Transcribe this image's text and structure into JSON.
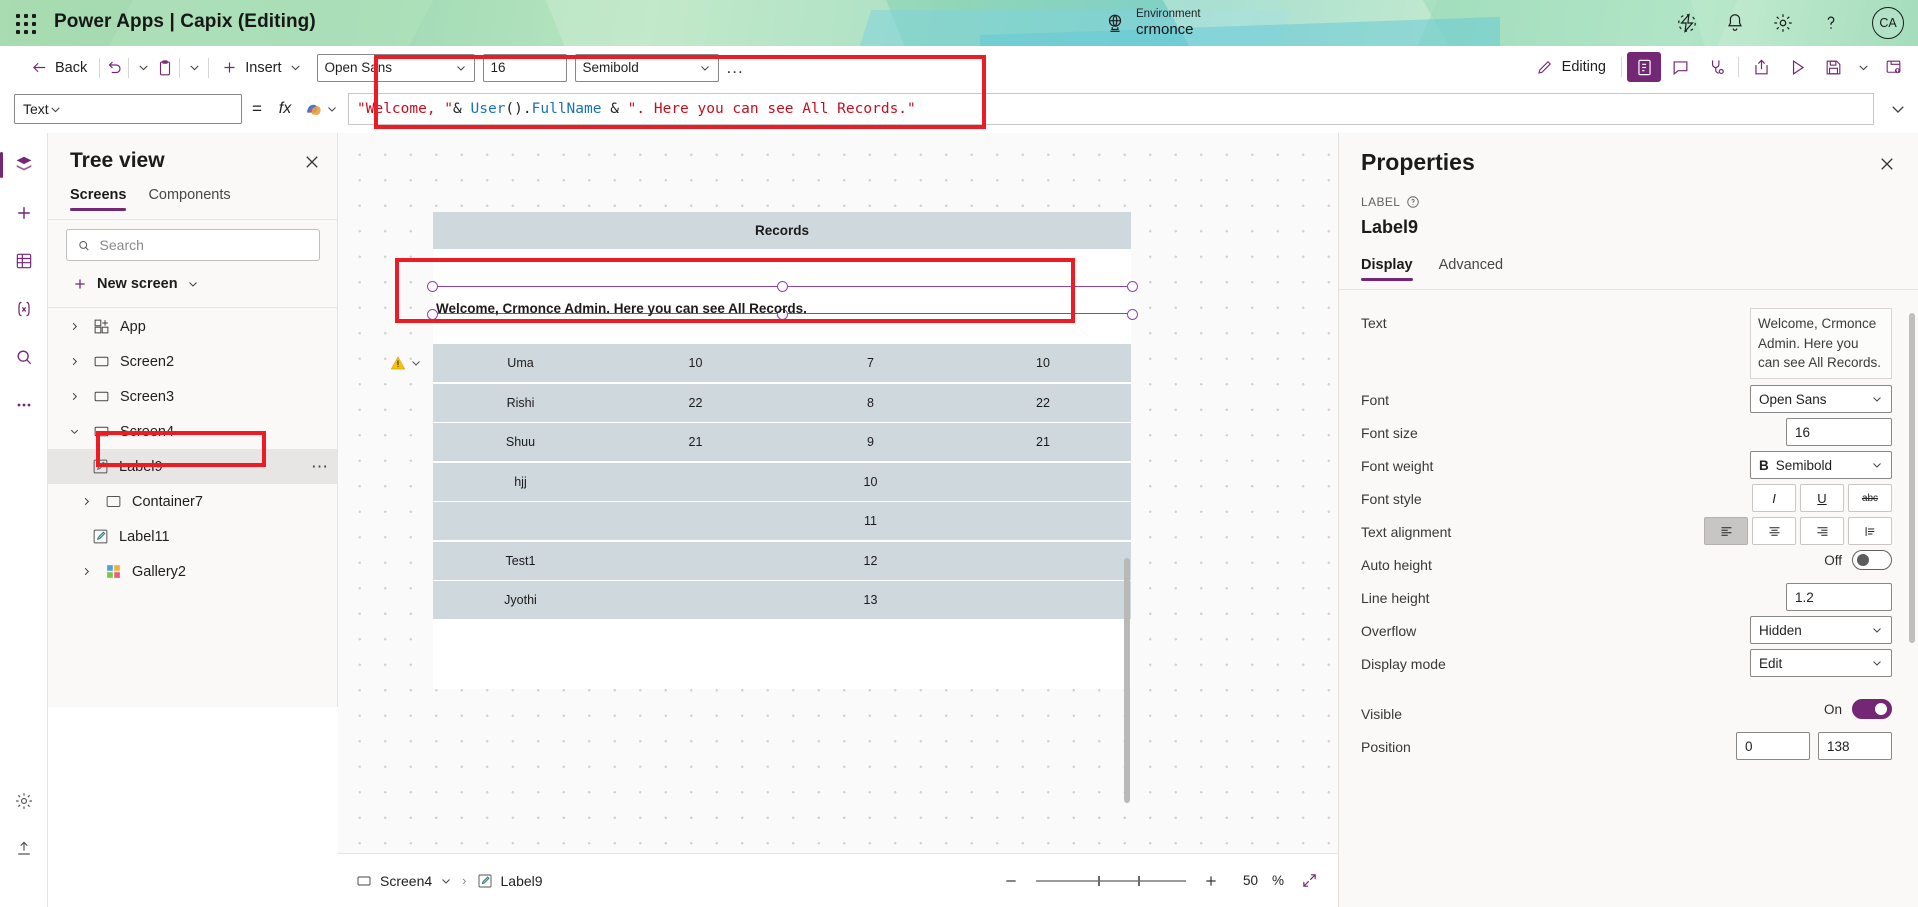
{
  "header": {
    "brand": "Power Apps  |  Capix (Editing)",
    "waffle_icon": "app-launcher-icon",
    "environment_label": "Environment",
    "environment_name": "crmonce",
    "globe_icon": "globe-icon",
    "icons": [
      "diagnostics-icon",
      "notification-bell-icon",
      "settings-gear-icon",
      "help-question-icon"
    ],
    "avatar_initials": "CA",
    "accent_color": "#742774",
    "header_color": "#9fd9b4"
  },
  "toolbar": {
    "back_label": "Back",
    "back_icon": "arrow-left-icon",
    "undo_icon": "undo-icon",
    "undo_caret_icon": "chevron-down-icon",
    "paste_icon": "clipboard-paste-icon",
    "paste_caret_icon": "chevron-down-icon",
    "insert_label": "Insert",
    "insert_icon": "plus-icon",
    "insert_caret_icon": "chevron-down-icon",
    "font_family": "Open Sans",
    "font_size": "16",
    "font_weight": "Semibold",
    "overflow_label": "...",
    "editing_label": "Editing",
    "edit_icon": "pencil-icon",
    "right_icons": [
      "app-checker-icon",
      "comments-icon",
      "app-health-icon",
      "share-icon",
      "preview-play-icon",
      "save-icon",
      "save-caret-icon",
      "publish-icon"
    ]
  },
  "formula_bar": {
    "property": "Text",
    "property_caret_icon": "chevron-down-icon",
    "equals": "=",
    "fx_icon": "fx",
    "copilot_icon": "copilot-icon",
    "copilot_caret_icon": "chevron-down-icon",
    "formula_parts": [
      {
        "t": "\"Welcome, \"",
        "c": "str"
      },
      {
        "t": "& ",
        "c": "op"
      },
      {
        "t": "User",
        "c": "fn"
      },
      {
        "t": "().",
        "c": "op"
      },
      {
        "t": "FullName",
        "c": "fn"
      },
      {
        "t": " & ",
        "c": "op"
      },
      {
        "t": "\". Here you can see All Records.\"",
        "c": "str"
      }
    ],
    "formula_plain": "\"Welcome, \"& User().FullName & \". Here you can see All Records.\"",
    "expand_icon": "chevron-down-icon"
  },
  "tree_view": {
    "title": "Tree view",
    "close_icon": "close-icon",
    "tabs": [
      {
        "label": "Screens",
        "active": true
      },
      {
        "label": "Components",
        "active": false
      }
    ],
    "search": {
      "placeholder": "Search",
      "value": "",
      "icon": "search-icon"
    },
    "new_screen": {
      "label": "New screen",
      "icon": "plus-icon",
      "caret_icon": "chevron-down-icon"
    },
    "nodes": [
      {
        "label": "App",
        "icon": "app-icon",
        "indent": 0,
        "chevron": "right",
        "selected": false
      },
      {
        "label": "Screen2",
        "icon": "screen-icon",
        "indent": 0,
        "chevron": "right",
        "selected": false
      },
      {
        "label": "Screen3",
        "icon": "screen-icon",
        "indent": 0,
        "chevron": "right",
        "selected": false
      },
      {
        "label": "Screen4",
        "icon": "screen-icon",
        "indent": 0,
        "chevron": "down",
        "selected": false
      },
      {
        "label": "Label9",
        "icon": "label-icon",
        "indent": 1,
        "chevron": "none",
        "selected": true,
        "more_icon": "more-options-icon"
      },
      {
        "label": "Container7",
        "icon": "container-icon",
        "indent": 1,
        "chevron": "right",
        "selected": false
      },
      {
        "label": "Label11",
        "icon": "label-icon",
        "indent": 1,
        "chevron": "none",
        "selected": false
      },
      {
        "label": "Gallery2",
        "icon": "gallery-icon",
        "indent": 1,
        "chevron": "right",
        "selected": false
      }
    ]
  },
  "rail": {
    "items": [
      "tree-view-icon",
      "insert-icon",
      "data-icon",
      "variables-icon",
      "search-icon",
      "more-icon",
      "settings-icon",
      "publish-icon"
    ]
  },
  "canvas": {
    "table_title": "Records",
    "selected_label_text": "Welcome, Crmonce Admin. Here you can see All Records.",
    "warning_icon": "warning-triangle-icon",
    "warning_caret_icon": "chevron-down-icon",
    "rows": [
      {
        "c1": "Uma",
        "c2": "10",
        "c3": "7",
        "c4": "10"
      },
      {
        "c1": "Rishi",
        "c2": "22",
        "c3": "8",
        "c4": "22"
      },
      {
        "c1": "Shuu",
        "c2": "21",
        "c3": "9",
        "c4": "21"
      },
      {
        "c1": "hjj",
        "c2": "",
        "c3": "10",
        "c4": ""
      },
      {
        "c1": "",
        "c2": "",
        "c3": "11",
        "c4": ""
      },
      {
        "c1": "Test1",
        "c2": "",
        "c3": "12",
        "c4": ""
      },
      {
        "c1": "Jyothi",
        "c2": "",
        "c3": "13",
        "c4": ""
      }
    ]
  },
  "properties": {
    "title": "Properties",
    "close_icon": "close-icon",
    "kind_label": "LABEL",
    "help_icon": "help-circle-icon",
    "control_name": "Label9",
    "tabs": [
      {
        "label": "Display",
        "active": true
      },
      {
        "label": "Advanced",
        "active": false
      }
    ],
    "fields": {
      "text_label": "Text",
      "text_value": "Welcome, Crmonce Admin. Here you can see All Records.",
      "font_label": "Font",
      "font_value": "Open Sans",
      "font_size_label": "Font size",
      "font_size_value": "16",
      "font_weight_label": "Font weight",
      "font_weight_value": "Semibold",
      "font_weight_bold_glyph": "B",
      "font_style_label": "Font style",
      "font_style_italic": "I",
      "font_style_underline": "U",
      "font_style_strike": "abc",
      "text_alignment_label": "Text alignment",
      "text_alignment_options": [
        "align-left",
        "align-center",
        "align-right",
        "align-justify"
      ],
      "text_alignment_selected": 0,
      "auto_height_label": "Auto height",
      "auto_height_state": "Off",
      "line_height_label": "Line height",
      "line_height_value": "1.2",
      "overflow_label": "Overflow",
      "overflow_value": "Hidden",
      "display_mode_label": "Display mode",
      "display_mode_value": "Edit",
      "visible_label": "Visible",
      "visible_state": "On",
      "position_label": "Position",
      "position_x": "0",
      "position_y": "138"
    }
  },
  "status_bar": {
    "screen_name": "Screen4",
    "screen_icon": "screen-icon",
    "screen_caret_icon": "chevron-down-icon",
    "control_name": "Label9",
    "control_icon": "label-icon",
    "zoom_out_icon": "minus-icon",
    "zoom_in_icon": "plus-icon",
    "zoom_value": "50",
    "zoom_unit": "%",
    "fit_icon": "fit-screen-icon"
  }
}
